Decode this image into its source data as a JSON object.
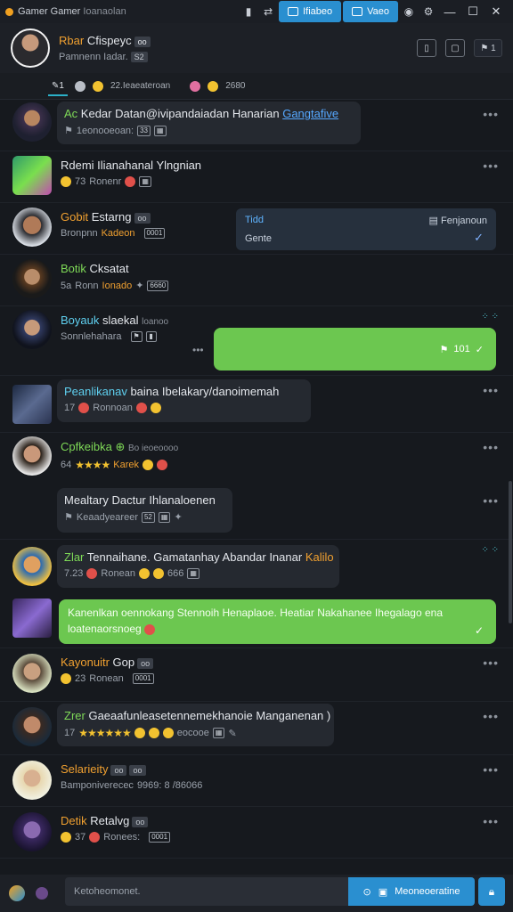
{
  "window": {
    "title": "Gamer Gamer",
    "title_sub": "Ioanaolan",
    "btn_primary": "Ifiabeo",
    "btn_secondary": "Vaeo"
  },
  "header": {
    "name_first": "Rbar",
    "name_last": "Cfispeyc",
    "name_chip": "oo",
    "status": "Pamnenn Iadar.",
    "status_chip": "S2"
  },
  "tabs": {
    "active": "1",
    "count_label": "22.Ieaeateroan",
    "count2": "2680"
  },
  "messages": [
    {
      "title_prefix": "Ac",
      "title": "Kedar Datan@ivipandaiadan Hanarian",
      "link": "Gangtafive",
      "sub": "1eonooeoan:",
      "chip": "33"
    },
    {
      "title": "Rdemi Ilianahanal Ylngnian",
      "sub_num": "73",
      "sub": "Ronenr"
    },
    {
      "name": "Gobit",
      "title": "Estarng",
      "chip": "oo",
      "sub": "Bronpnn",
      "sub_orange": "Kadeon",
      "sub_chip": "0001",
      "reply_title": "Tidd",
      "reply_right": "Fenjanoun",
      "reply_body": "Gente"
    },
    {
      "name": "Botik",
      "title": "Cksatat",
      "sub_num": "5a",
      "sub": "Ronn",
      "sub_orange": "Ionado",
      "sub_chip": "6660"
    },
    {
      "name": "Boyauk",
      "title": "slaekal",
      "title_tail": "loanoo",
      "sub": "Sonnlehahara",
      "out_text": "101"
    },
    {
      "name": "Peanlikanav",
      "title": "baina Ibelakary/danoimemah",
      "sub_num": "17",
      "sub": "Ronnoan"
    },
    {
      "name": "Cpfkeibka",
      "title_tail": "Bo ieoeoooo",
      "sub_num": "64",
      "sub_orange": "Karek"
    },
    {
      "title": "Mealtary Dactur Ihlanaloenen",
      "sub": "Keaadyeareer",
      "sub_chip": "52"
    },
    {
      "name": "Zlar",
      "title": "Tennaihane. Gamatanhay Abandar Inanar",
      "title_orange": "Kalilo",
      "sub_num": "7.23",
      "sub": "Ronean",
      "sub_chip": "666"
    },
    {
      "out_text": "Kanenlkan oennokang Stennoih Henaplaoe. Heatiar Nakahanee Ihegalago ena",
      "out_text2": "loatenaorsnoeg"
    },
    {
      "name": "Kayonuitr",
      "title": "Gop",
      "chip": "oo",
      "sub_num": "23",
      "sub": "Ronean",
      "sub_chip": "0001"
    },
    {
      "name": "Zrer",
      "title": "Gaeaafunleasetennemekhanoie Manganenan )",
      "sub_num": "17",
      "sub_tail": "eocooe"
    },
    {
      "name": "Selarieity",
      "chip": "oo",
      "sub": "Bamponiverecec",
      "sub_tail": "9969: 8 /86066"
    },
    {
      "name": "Detik",
      "title": "Retalvg",
      "chip": "oo",
      "sub_num": "37",
      "sub": "Ronees:",
      "sub_chip": "0001"
    }
  ],
  "composer": {
    "placeholder": "Ketoheomonet.",
    "send_label": "Meoneoeratine"
  },
  "colors": {
    "accent": "#2a8fd0",
    "outgoing": "#6cc750",
    "name_orange": "#f0a030",
    "name_green": "#7ed957"
  }
}
